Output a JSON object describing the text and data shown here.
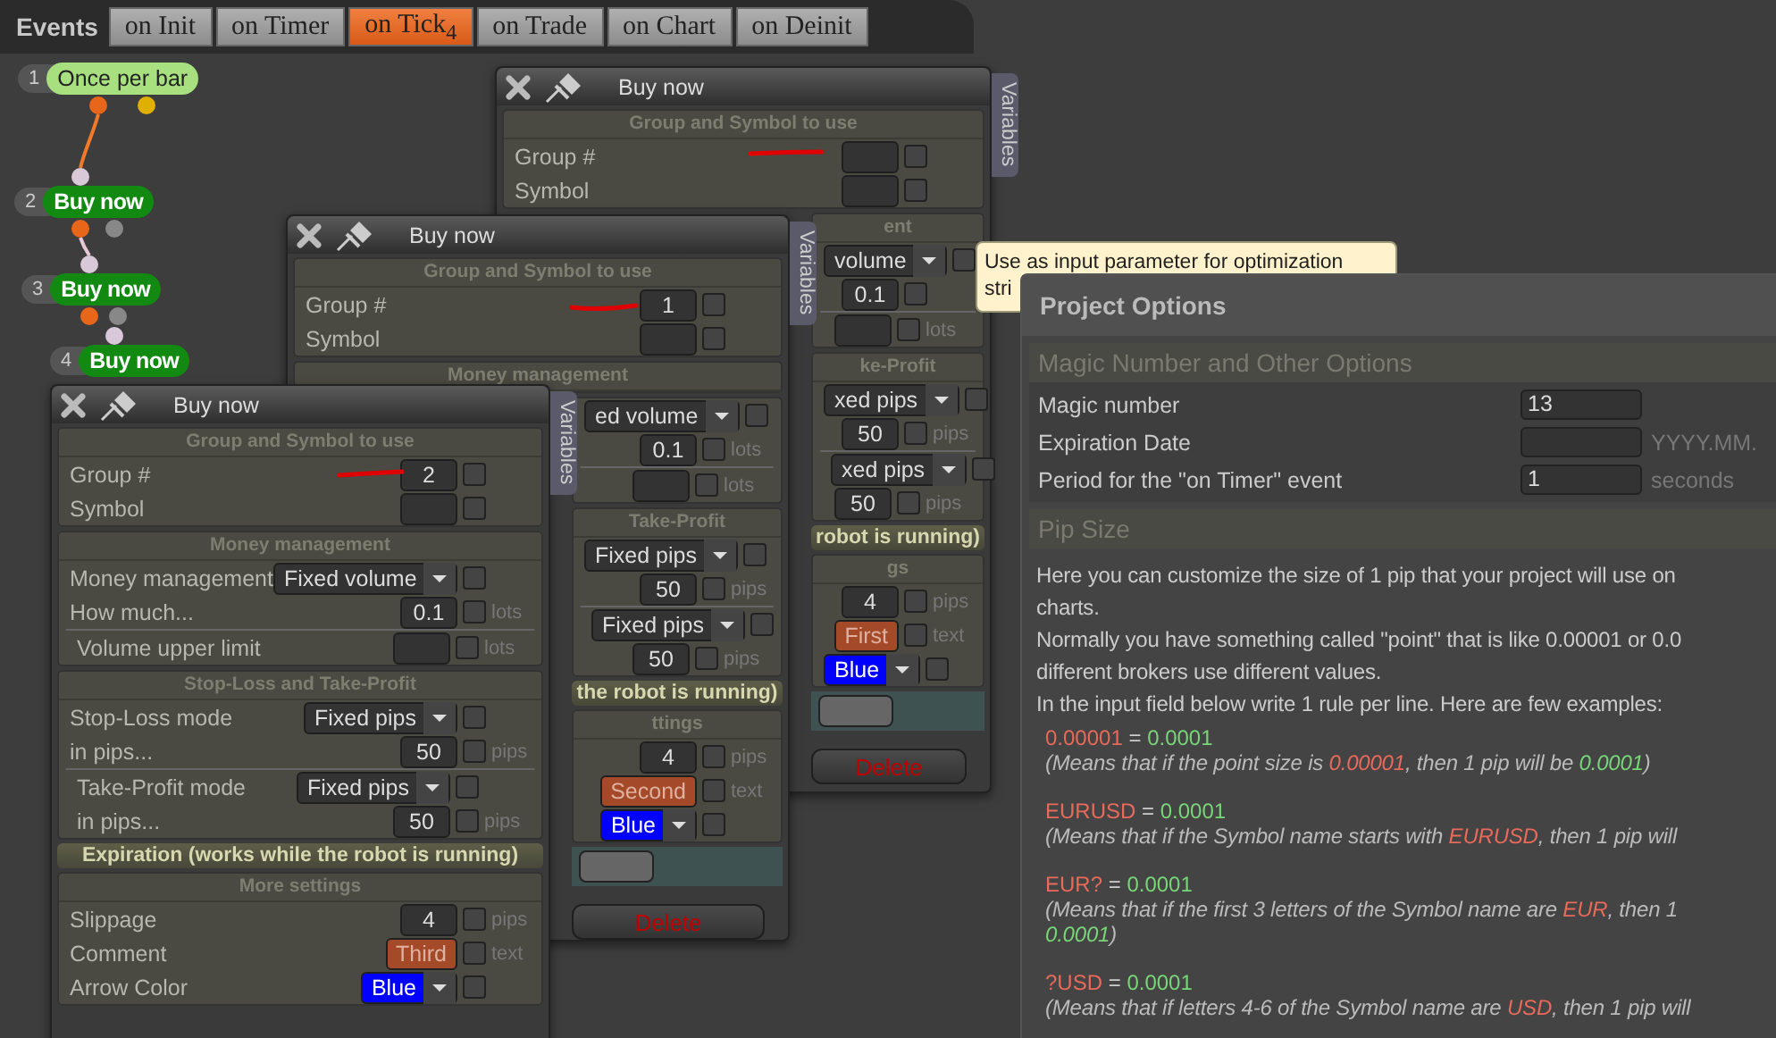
{
  "events_bar": {
    "label": "Events",
    "tabs": [
      {
        "label": "on Init",
        "selected": false
      },
      {
        "label": "on Timer",
        "selected": false
      },
      {
        "label": "on Tick",
        "selected": true,
        "badge": "4"
      },
      {
        "label": "on Trade",
        "selected": false
      },
      {
        "label": "on Chart",
        "selected": false
      },
      {
        "label": "on Deinit",
        "selected": false
      }
    ]
  },
  "flow_nodes": [
    {
      "number": "1",
      "label": "Once per bar",
      "kind": "condition"
    },
    {
      "number": "2",
      "label": "Buy now",
      "kind": "action"
    },
    {
      "number": "3",
      "label": "Buy now",
      "kind": "action"
    },
    {
      "number": "4",
      "label": "Buy now",
      "kind": "action"
    }
  ],
  "windows": [
    {
      "title": "Buy now",
      "side_tab": "Variables",
      "sections": [
        {
          "kind": "panel",
          "heading": "Group and Symbol to use",
          "groups": [
            [
              {
                "kind": "input",
                "label": "Group #",
                "checked": false
              },
              {
                "kind": "input",
                "label": "Symbol",
                "checked": false
              }
            ]
          ]
        }
      ],
      "strip": [
        {
          "kind": "panel",
          "heading": "ent",
          "groups": [
            [
              {
                "kind": "select",
                "value": "volume",
                "checked": false
              },
              {
                "kind": "input",
                "value": "0.1",
                "checked": false
              }
            ],
            [
              {
                "kind": "input",
                "unit": "lots",
                "checked": false
              }
            ]
          ]
        },
        {
          "kind": "panel",
          "heading": "ke-Profit",
          "groups": [
            [
              {
                "kind": "select",
                "value": "xed pips",
                "checked": false
              },
              {
                "kind": "input",
                "value": "50",
                "unit": "pips",
                "checked": false
              }
            ],
            [
              {
                "kind": "select",
                "value": "xed pips",
                "checked": false
              },
              {
                "kind": "input",
                "value": "50",
                "unit": "pips",
                "checked": false
              }
            ]
          ]
        },
        {
          "kind": "banner",
          "heading": "robot is running)"
        },
        {
          "kind": "panel",
          "heading": "gs",
          "groups": [
            [
              {
                "kind": "input",
                "value": "4",
                "unit": "pips",
                "checked": false
              },
              {
                "kind": "chip",
                "value": "First",
                "unit": "text",
                "checked": false
              },
              {
                "kind": "color",
                "value": "Blue",
                "checked": false
              }
            ]
          ]
        }
      ],
      "footer_button": "Delete"
    },
    {
      "title": "Buy now",
      "side_tab": "Variables",
      "sections": [
        {
          "kind": "panel",
          "heading": "Group and Symbol to use",
          "groups": [
            [
              {
                "kind": "input",
                "label": "Group #",
                "value": "1",
                "checked": false
              },
              {
                "kind": "input",
                "label": "Symbol",
                "checked": false
              }
            ]
          ]
        },
        {
          "kind": "panel",
          "heading": "Money management"
        }
      ],
      "strip": [
        {
          "kind": "panel",
          "groups": [
            [
              {
                "kind": "select",
                "value": "ed volume",
                "checked": false
              },
              {
                "kind": "input",
                "value": "0.1",
                "unit": "lots",
                "checked": false
              }
            ],
            [
              {
                "kind": "input",
                "unit": "lots",
                "checked": false
              }
            ]
          ]
        },
        {
          "kind": "panel",
          "heading": "Take-Profit",
          "groups": [
            [
              {
                "kind": "select",
                "value": "Fixed pips",
                "checked": false
              },
              {
                "kind": "input",
                "value": "50",
                "unit": "pips",
                "checked": false
              }
            ],
            [
              {
                "kind": "select",
                "value": "Fixed pips",
                "checked": false
              },
              {
                "kind": "input",
                "value": "50",
                "unit": "pips",
                "checked": false
              }
            ]
          ]
        },
        {
          "kind": "banner",
          "heading": "the robot is running)"
        },
        {
          "kind": "panel",
          "heading": "ttings",
          "groups": [
            [
              {
                "kind": "input",
                "value": "4",
                "unit": "pips",
                "checked": false
              },
              {
                "kind": "chip",
                "value": "Second",
                "unit": "text",
                "checked": false
              },
              {
                "kind": "color",
                "value": "Blue",
                "checked": false
              }
            ]
          ]
        }
      ],
      "footer_button": "Delete"
    },
    {
      "title": "Buy now",
      "side_tab": "Variables",
      "sections": [
        {
          "kind": "panel",
          "heading": "Group and Symbol to use",
          "groups": [
            [
              {
                "kind": "input",
                "label": "Group #",
                "value": "2",
                "checked": false
              },
              {
                "kind": "input",
                "label": "Symbol",
                "checked": false
              }
            ]
          ]
        },
        {
          "kind": "panel",
          "heading": "Money management",
          "groups": [
            [
              {
                "kind": "select",
                "label": "Money management",
                "value": "Fixed volume",
                "checked": false
              },
              {
                "kind": "input",
                "label": "How much...",
                "value": "0.1",
                "unit": "lots",
                "checked": false
              }
            ],
            [
              {
                "kind": "input",
                "label": "Volume upper limit",
                "unit": "lots",
                "checked": false
              }
            ]
          ]
        },
        {
          "kind": "panel",
          "heading": "Stop-Loss and Take-Profit",
          "groups": [
            [
              {
                "kind": "select",
                "label": "Stop-Loss mode",
                "value": "Fixed pips",
                "checked": false
              },
              {
                "kind": "input",
                "label": "in pips...",
                "value": "50",
                "unit": "pips",
                "checked": false
              }
            ],
            [
              {
                "kind": "select",
                "label": "Take-Profit mode",
                "value": "Fixed pips",
                "checked": false
              },
              {
                "kind": "input",
                "label": "in pips...",
                "value": "50",
                "unit": "pips",
                "checked": false
              }
            ]
          ]
        },
        {
          "kind": "banner",
          "heading": "Expiration (works while the robot is running)"
        },
        {
          "kind": "panel",
          "heading": "More settings",
          "groups": [
            [
              {
                "kind": "input",
                "label": "Slippage",
                "value": "4",
                "unit": "pips",
                "checked": false
              },
              {
                "kind": "chip",
                "label": "Comment",
                "value": "Third",
                "unit": "text",
                "checked": false
              },
              {
                "kind": "color",
                "label": "Arrow Color",
                "value": "Blue",
                "checked": false
              }
            ]
          ]
        }
      ]
    }
  ],
  "tooltip": {
    "lines": [
      "Use as input parameter for optimization",
      "stri"
    ]
  },
  "project_options": {
    "title": "Project Options",
    "options_section": {
      "heading": "Magic Number and Other Options",
      "rows": [
        {
          "label": "Magic number",
          "value": "13"
        },
        {
          "label": "Expiration Date",
          "unit": "YYYY.MM."
        },
        {
          "label": "Period for the \"on Timer\" event",
          "value": "1",
          "unit": "seconds"
        }
      ]
    },
    "pip_section": {
      "heading": "Pip Size",
      "lines": [
        "Here you can customize the size of 1 pip that your project will use on",
        "charts.",
        "Normally you have something called \"point\" that is like 0.00001 or 0.0",
        "different brokers use different values.",
        "In the input field below write 1 rule per line. Here are few examples:"
      ],
      "examples": [
        {
          "rule": [
            {
              "text": "0.00001",
              "kind": "key"
            },
            {
              "text": " = ",
              "kind": "plain"
            },
            {
              "text": "0.0001",
              "kind": "value"
            }
          ],
          "explanation": [
            [
              {
                "text": "(Means that if the point size is ",
                "kind": "plain"
              },
              {
                "text": "0.00001",
                "kind": "key"
              },
              {
                "text": ", then 1 pip will be ",
                "kind": "plain"
              },
              {
                "text": "0.0001",
                "kind": "value"
              },
              {
                "text": ")",
                "kind": "plain"
              }
            ]
          ]
        },
        {
          "rule": [
            {
              "text": "EURUSD",
              "kind": "key"
            },
            {
              "text": " = ",
              "kind": "plain"
            },
            {
              "text": "0.0001",
              "kind": "value"
            }
          ],
          "explanation": [
            [
              {
                "text": "(Means that if the Symbol name starts with ",
                "kind": "plain"
              },
              {
                "text": "EURUSD",
                "kind": "key"
              },
              {
                "text": ", then 1 pip will",
                "kind": "plain"
              }
            ]
          ]
        },
        {
          "rule": [
            {
              "text": "EUR?",
              "kind": "key"
            },
            {
              "text": " = ",
              "kind": "plain"
            },
            {
              "text": "0.0001",
              "kind": "value"
            }
          ],
          "explanation": [
            [
              {
                "text": "(Means that if the first 3 letters of the Symbol name are ",
                "kind": "plain"
              },
              {
                "text": "EUR",
                "kind": "key"
              },
              {
                "text": ", then 1",
                "kind": "plain"
              }
            ],
            [
              {
                "text": "0.0001",
                "kind": "value"
              },
              {
                "text": ")",
                "kind": "plain"
              }
            ]
          ]
        },
        {
          "rule": [
            {
              "text": "?USD",
              "kind": "key"
            },
            {
              "text": " = ",
              "kind": "plain"
            },
            {
              "text": "0.0001",
              "kind": "value"
            }
          ],
          "explanation": [
            [
              {
                "text": "(Means that if letters 4-6 of the Symbol name are ",
                "kind": "plain"
              },
              {
                "text": "USD",
                "kind": "key"
              },
              {
                "text": ", then 1 pip will",
                "kind": "plain"
              }
            ]
          ]
        }
      ]
    }
  }
}
